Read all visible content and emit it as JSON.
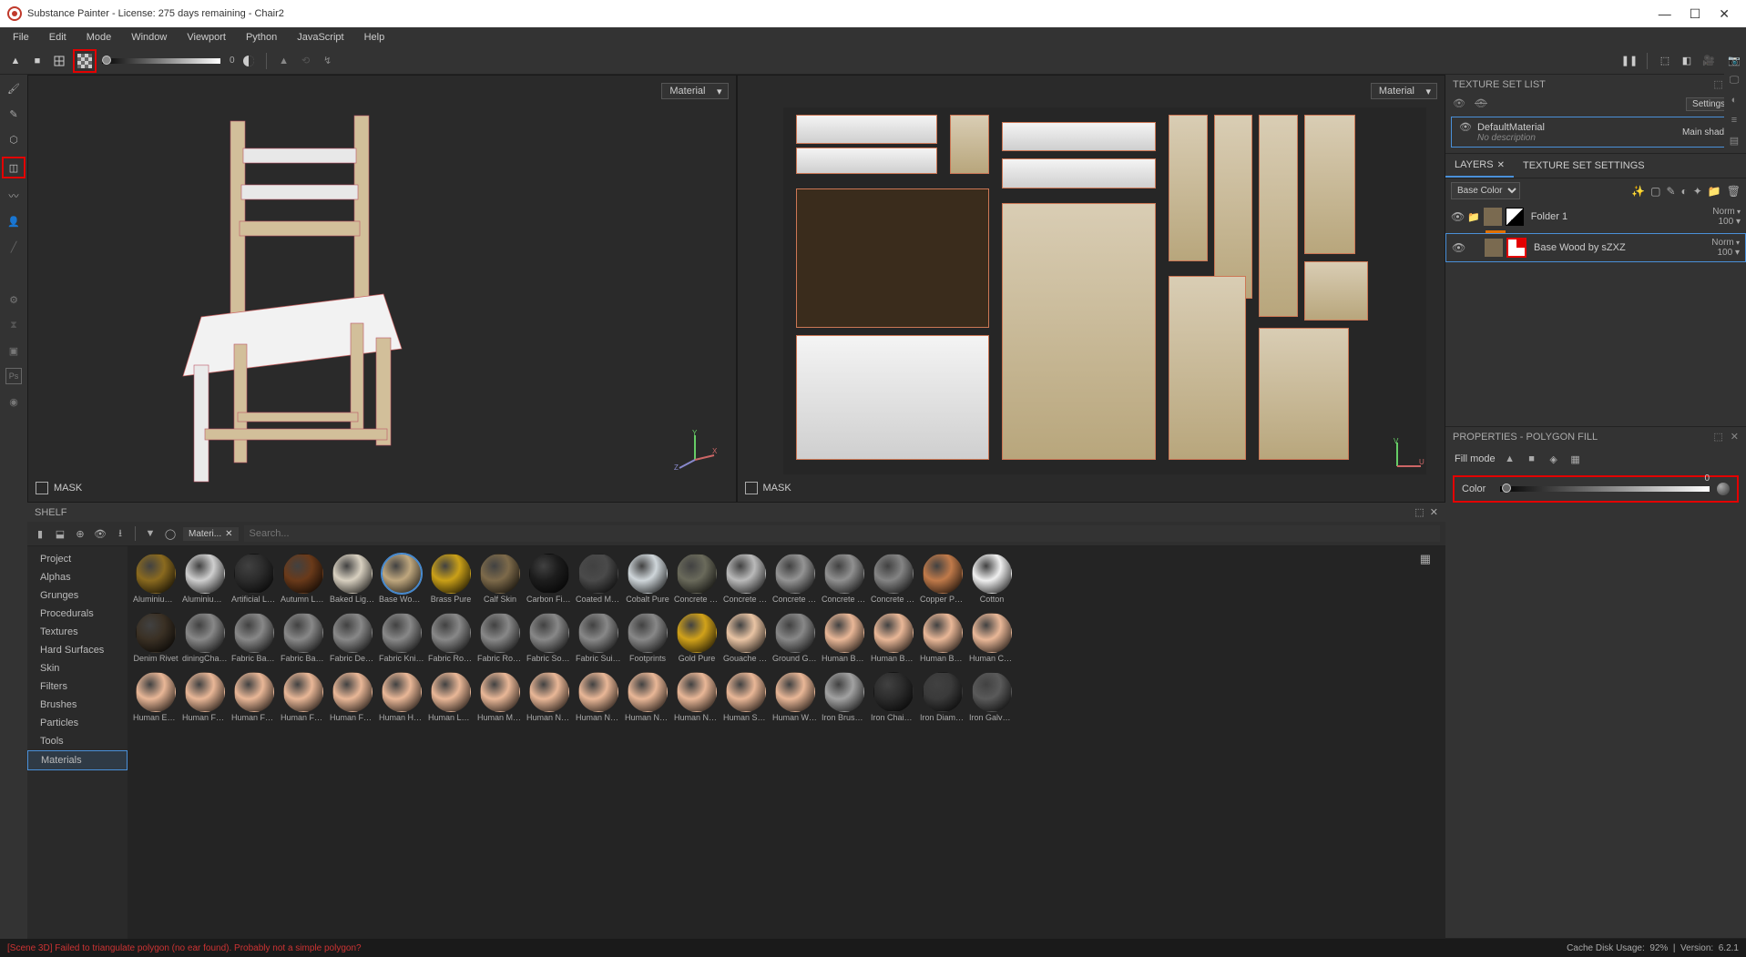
{
  "title": "Substance Painter - License: 275 days remaining - Chair2",
  "menu": [
    "File",
    "Edit",
    "Mode",
    "Window",
    "Viewport",
    "Python",
    "JavaScript",
    "Help"
  ],
  "toolbar": {
    "slider_label": "0"
  },
  "viewport": {
    "channel_dd": "Material",
    "mask_label": "MASK"
  },
  "texture_set_list": {
    "title": "TEXTURE SET LIST",
    "settings_btn": "Settings",
    "default_material": "DefaultMaterial",
    "shader": "Main shader",
    "no_desc": "No description"
  },
  "layers": {
    "tab_layers": "LAYERS",
    "tab_tss": "TEXTURE SET SETTINGS",
    "channel_dd": "Base Color",
    "folder1": {
      "name": "Folder 1",
      "blend": "Norm",
      "opacity": "100"
    },
    "baseWood": {
      "name": "Base Wood by sZXZ",
      "blend": "Norm",
      "opacity": "100"
    }
  },
  "properties": {
    "title": "PROPERTIES - POLYGON FILL",
    "fill_mode": "Fill mode",
    "color_label": "Color",
    "color_value": "0"
  },
  "shelf": {
    "title": "SHELF",
    "tab": "Materi...",
    "search_ph": "Search...",
    "categories": [
      "Project",
      "Alphas",
      "Grunges",
      "Procedurals",
      "Textures",
      "Hard Surfaces",
      "Skin",
      "Filters",
      "Brushes",
      "Particles",
      "Tools",
      "Materials"
    ],
    "selected_cat": "Materials",
    "materials_row1": [
      "Aluminium ...",
      "Aluminium ...",
      "Artificial Lea...",
      "Autumn Leaf",
      "Baked Light...",
      "Base Wood...",
      "Brass Pure",
      "Calf Skin",
      "Carbon Fiber",
      "Coated Metal",
      "Cobalt Pure",
      "Concrete B...",
      "Concrete Cl...",
      "Concrete D...",
      "Concrete Si...",
      "Concrete S...",
      "Copper Pure",
      "Cotton"
    ],
    "colors_row1": [
      "#8a6a1f",
      "#cfcfcf",
      "#2c2c2c",
      "#6a3a1a",
      "#d8d0c0",
      "#bfa77e",
      "#caa018",
      "#7d6a4a",
      "#1d1d1d",
      "#4a4a4a",
      "#cfd6da",
      "#6a6a5b",
      "#bababa",
      "#949494",
      "#909090",
      "#848484",
      "#c07a4a",
      "#efefef"
    ],
    "materials_row2": [
      "Denim Rivet",
      "diningChair...",
      "Fabric Bam...",
      "Fabric Base...",
      "Fabric Deni...",
      "Fabric Knitt...",
      "Fabric Rough",
      "Fabric Rou...",
      "Fabric Soft ...",
      "Fabric Suit ...",
      "Footprints",
      "Gold Pure",
      "Gouache P...",
      "Ground Gra...",
      "Human Bac...",
      "Human Bell...",
      "Human Bu...",
      "Human Ch..."
    ],
    "colors_row2": [
      "#3a3024",
      "#888888",
      "#888888",
      "#888888",
      "#888888",
      "#888888",
      "#888888",
      "#888888",
      "#888888",
      "#888888",
      "#888888",
      "#d1a21a",
      "#e9c4a4",
      "#888888",
      "#e9b797",
      "#e9b797",
      "#e9b797",
      "#e9b797"
    ],
    "materials_row3": [
      "Human Eye...",
      "Human Fac...",
      "Human Fee...",
      "Human For...",
      "Human For...",
      "Human He...",
      "Human Leg...",
      "Human Mo...",
      "Human Ne...",
      "Human Ne...",
      "Human No...",
      "Human No...",
      "Human Shi...",
      "Human Wri...",
      "Iron Brushed",
      "Iron Chain ...",
      "Iron Diamo...",
      "Iron Galvan..."
    ],
    "colors_row3": [
      "#e9b797",
      "#e9b797",
      "#e9b797",
      "#e9b797",
      "#e9b797",
      "#e9b797",
      "#e9b797",
      "#e9b797",
      "#e9b797",
      "#e9b797",
      "#e9b797",
      "#e9b797",
      "#e9b797",
      "#e9b797",
      "#a2a2a2",
      "#2c2c2c",
      "#3a3a3a",
      "#5a5a5a"
    ],
    "selected_material": 5
  },
  "status": {
    "error": "[Scene 3D] Failed to triangulate polygon (no ear found). Probably not a simple polygon?",
    "cache_label": "Cache Disk Usage:",
    "cache_pct": "92%",
    "version_label": "Version:",
    "version": "6.2.1"
  }
}
